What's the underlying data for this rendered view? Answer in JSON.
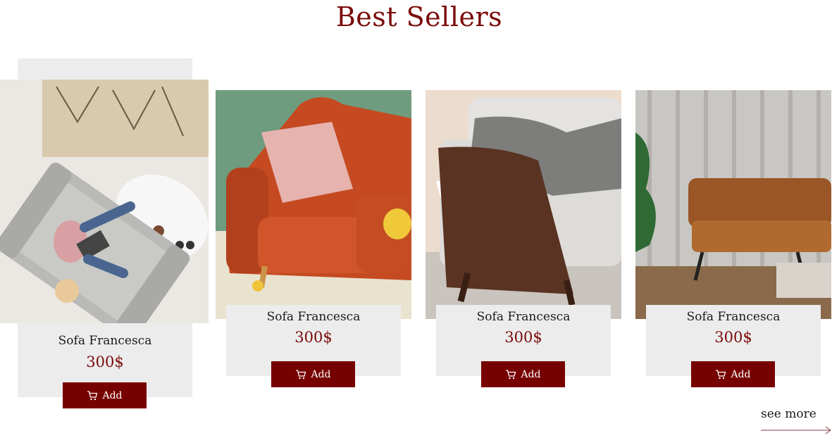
{
  "section": {
    "title": "Best Sellers"
  },
  "products": [
    {
      "name": "Sofa Francesca",
      "price": "300$",
      "add_label": "Add",
      "image": "grey-sofa-top-view",
      "icon": "cart-icon"
    },
    {
      "name": "Sofa Francesca",
      "price": "300$",
      "add_label": "Add",
      "image": "orange-sofa",
      "icon": "cart-icon"
    },
    {
      "name": "Sofa Francesca",
      "price": "300$",
      "add_label": "Add",
      "image": "walnut-armchair",
      "icon": "cart-icon"
    },
    {
      "name": "Sofa Francesca",
      "price": "300$",
      "add_label": "Add",
      "image": "leather-sofa",
      "icon": "cart-icon"
    }
  ],
  "see_more": {
    "label": "see more",
    "icon": "arrow-right-icon"
  },
  "colors": {
    "accent": "#770000",
    "title": "#7a0a0a",
    "card_bg": "#ececec"
  }
}
